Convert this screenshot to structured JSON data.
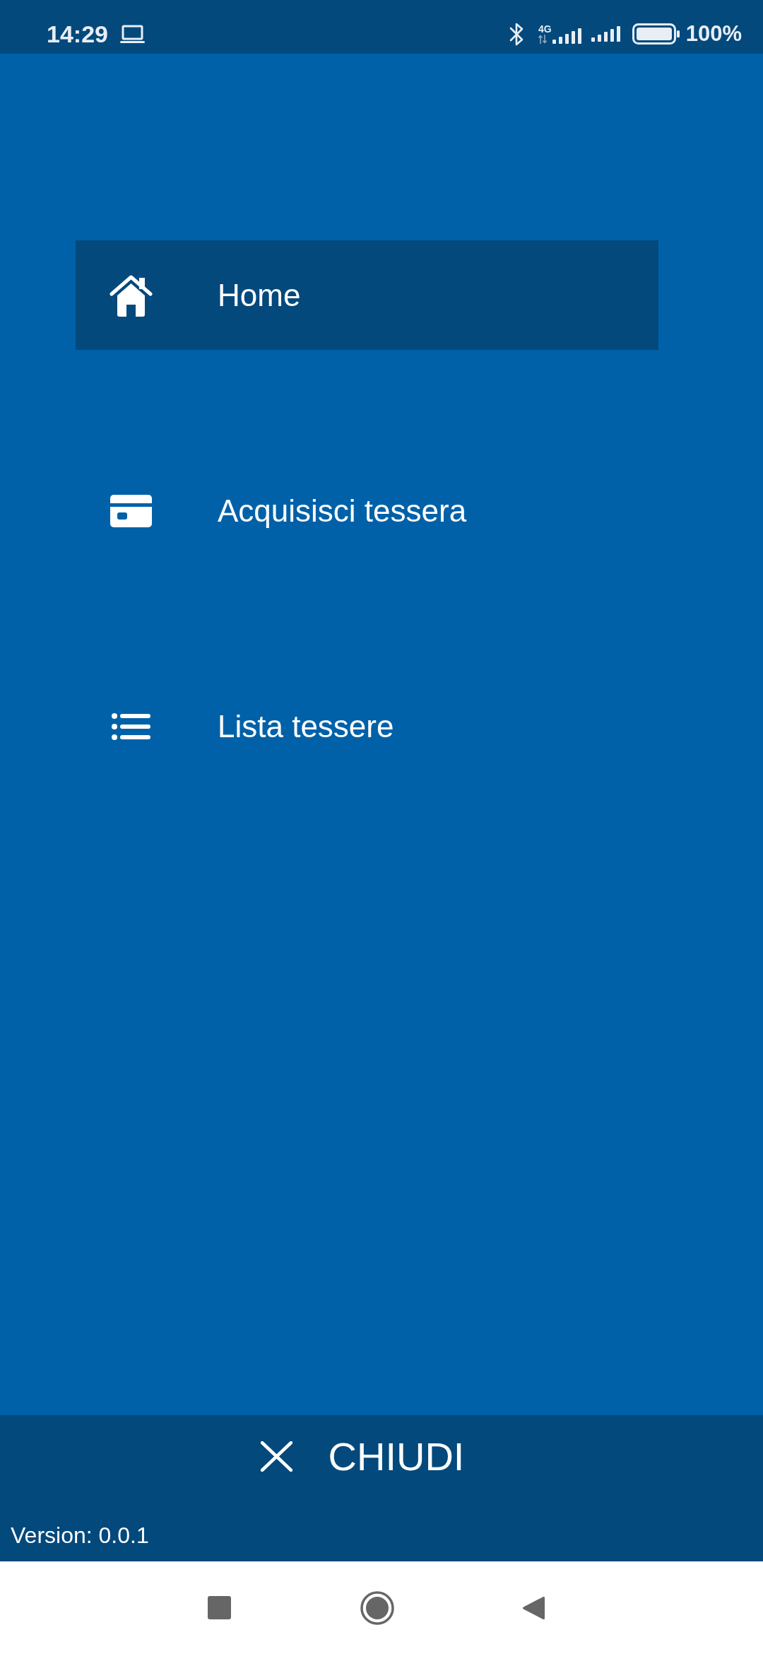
{
  "status_bar": {
    "time": "14:29",
    "network_type": "4G",
    "battery_text": "100%"
  },
  "menu": {
    "items": [
      {
        "kind": "home",
        "label": "Home",
        "selected": true
      },
      {
        "kind": "card",
        "label": "Acquisisci tessera",
        "selected": false
      },
      {
        "kind": "list",
        "label": "Lista tessere",
        "selected": false
      }
    ]
  },
  "footer": {
    "close_button": {
      "label": "CHIUDI"
    },
    "version": "Version: 0.0.1"
  }
}
